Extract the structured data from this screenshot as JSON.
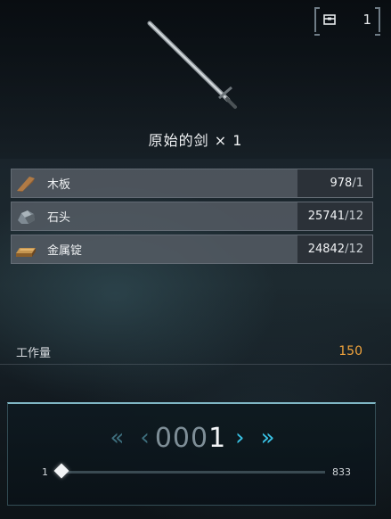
{
  "owned_count": "1",
  "item": {
    "name": "原始的剑",
    "quantity_label": "× 1"
  },
  "materials": [
    {
      "name": "木板",
      "have": "978",
      "need": "/1",
      "icon": "wood-plank-icon"
    },
    {
      "name": "石头",
      "have": "25741",
      "need": "/12",
      "icon": "stone-icon"
    },
    {
      "name": "金属锭",
      "have": "24842",
      "need": "/12",
      "icon": "metal-ingot-icon"
    }
  ],
  "workload": {
    "label": "工作量",
    "value": "150"
  },
  "quantity": {
    "lead_digits": "000",
    "last_digit": "1",
    "min": "1",
    "max": "833",
    "current": 1
  },
  "colors": {
    "accent": "#39c3e6",
    "workload": "#f0a33c"
  }
}
